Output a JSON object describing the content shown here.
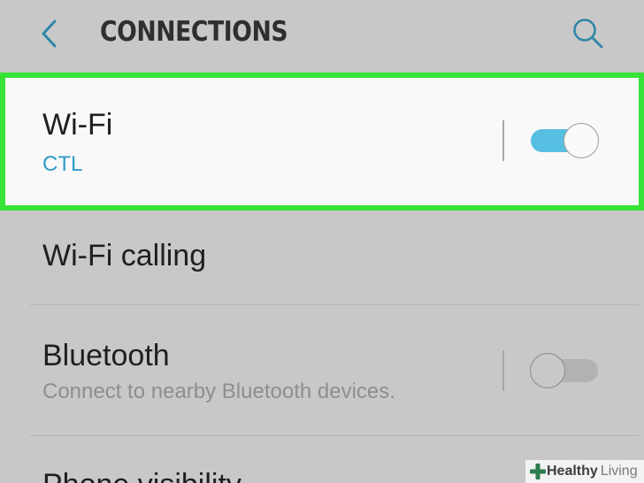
{
  "header": {
    "title": "CONNECTIONS",
    "back_icon": "chevron-left-icon",
    "search_icon": "search-icon"
  },
  "items": [
    {
      "title": "Wi-Fi",
      "subtitle": "CTL",
      "has_toggle": true,
      "toggle_on": true,
      "highlighted": true
    },
    {
      "title": "Wi-Fi calling",
      "has_toggle": false
    },
    {
      "title": "Bluetooth",
      "subtitle": "Connect to nearby Bluetooth devices.",
      "has_toggle": true,
      "toggle_on": false
    },
    {
      "title": "Phone visibility",
      "has_toggle": false
    }
  ],
  "watermark": {
    "brand_bold": "Healthy",
    "brand_regular": "Living"
  },
  "colors": {
    "accent": "#2e9cc9",
    "toggle_on": "#56bfe2",
    "highlight_border": "#37e337",
    "background": "#c8c8c8",
    "selected_row_bg": "#f9f9f9"
  }
}
